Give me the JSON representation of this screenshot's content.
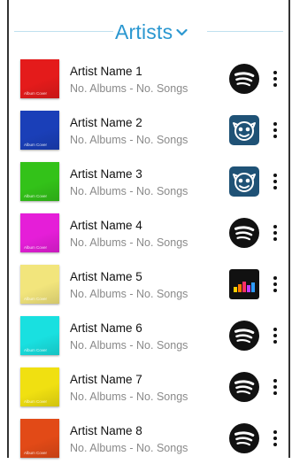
{
  "header": {
    "title": "Artists",
    "chevron_icon": "chevron-down-icon",
    "accent": "#2a97d0"
  },
  "artists": [
    {
      "name": "Artist Name 1",
      "meta": "No. Albums - No. Songs",
      "cover_label": "Album Cover",
      "cover_color": "#e41b1b",
      "service_icon": "spotify-icon"
    },
    {
      "name": "Artist Name 2",
      "meta": "No. Albums - No. Songs",
      "cover_label": "Album Cover",
      "cover_color": "#1a3fb8",
      "service_icon": "napster-icon"
    },
    {
      "name": "Artist Name 3",
      "meta": "No. Albums - No. Songs",
      "cover_label": "Album Cover",
      "cover_color": "#33c219",
      "service_icon": "napster-icon"
    },
    {
      "name": "Artist Name 4",
      "meta": "No. Albums - No. Songs",
      "cover_label": "Album Cover",
      "cover_color": "#e51ed8",
      "service_icon": "spotify-icon"
    },
    {
      "name": "Artist Name 5",
      "meta": "No. Albums - No. Songs",
      "cover_label": "Album Cover",
      "cover_color": "#f2e57c",
      "service_icon": "deezer-icon"
    },
    {
      "name": "Artist Name 6",
      "meta": "No. Albums - No. Songs",
      "cover_label": "Album Cover",
      "cover_color": "#19e0e0",
      "service_icon": "spotify-icon"
    },
    {
      "name": "Artist Name 7",
      "meta": "No. Albums - No. Songs",
      "cover_label": "Album Cover",
      "cover_color": "#f0e011",
      "service_icon": "spotify-icon"
    },
    {
      "name": "Artist Name 8",
      "meta": "No. Albums - No. Songs",
      "cover_label": "Album Cover",
      "cover_color": "#e24a17",
      "service_icon": "spotify-icon"
    }
  ]
}
